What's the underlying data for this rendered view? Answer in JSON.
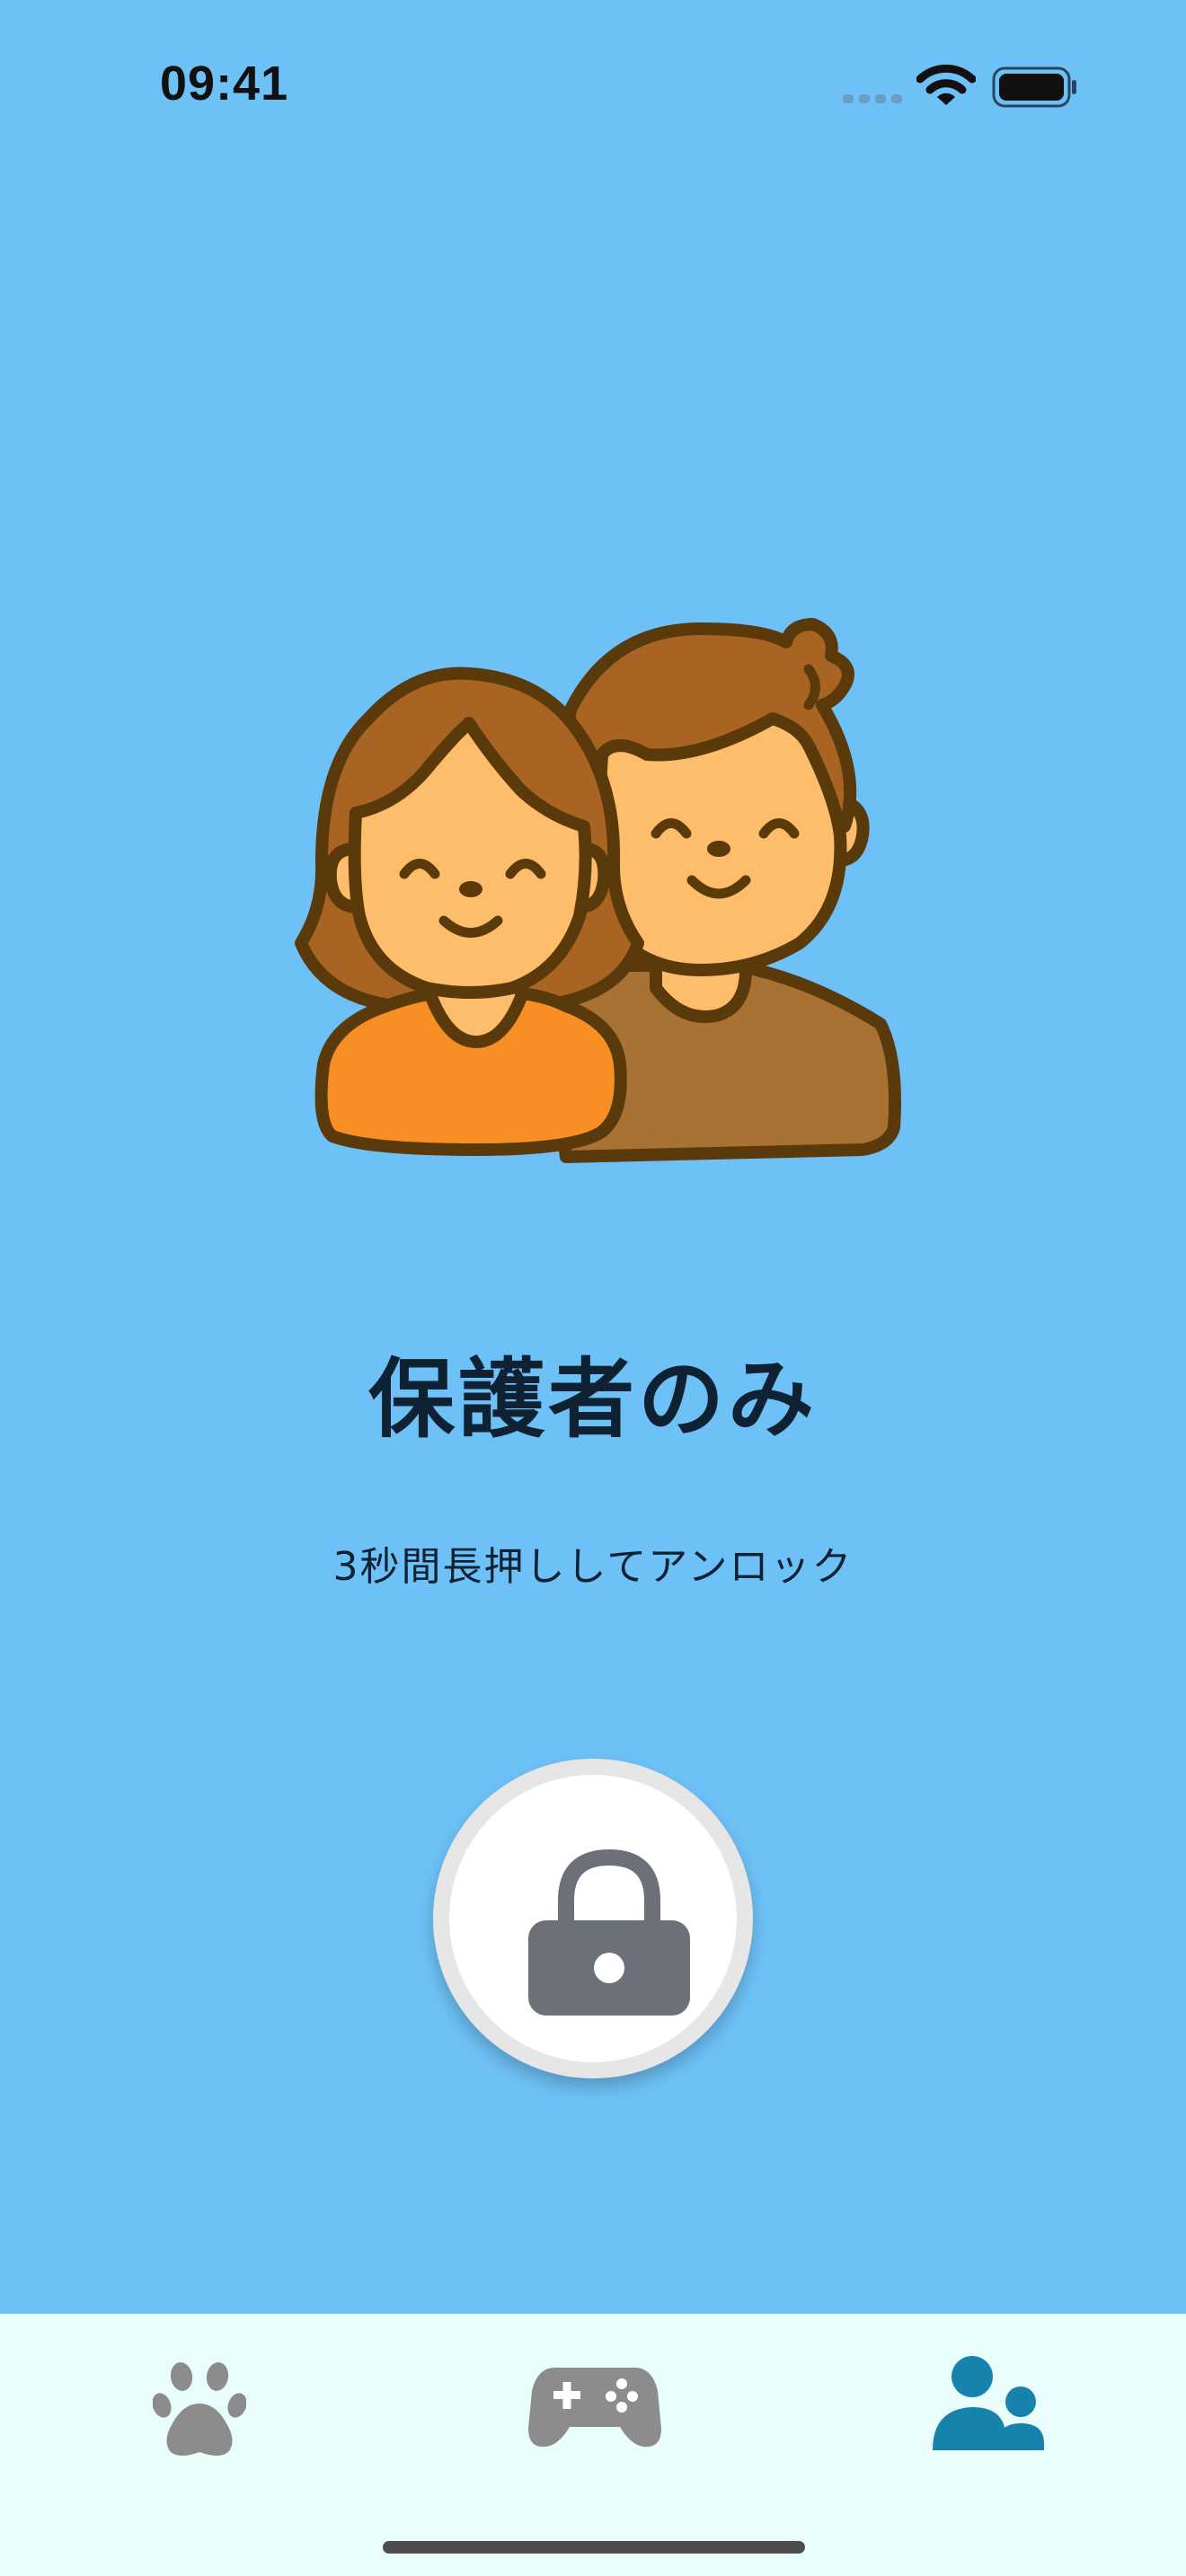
{
  "status_bar": {
    "time": "09:41",
    "icons": [
      "cellular-signal-icon",
      "wifi-icon",
      "battery-icon"
    ]
  },
  "illustration": {
    "icon": "parents-couple-icon"
  },
  "main": {
    "title": "保護者のみ",
    "subtitle": "3秒間長押ししてアンロック",
    "lock_button_icon": "lock-icon"
  },
  "tab_bar": {
    "tabs": [
      {
        "icon": "paw-icon",
        "selected": false
      },
      {
        "icon": "gamepad-icon",
        "selected": false
      },
      {
        "icon": "parents-icon",
        "selected": true
      }
    ]
  },
  "colors": {
    "background": "#6ec1f7",
    "tab_bar_background": "#e8fdfc",
    "tab_inactive": "#8c8c8c",
    "tab_active": "#1683ac",
    "title_text": "#0f2233",
    "lock_icon": "#6b7079"
  }
}
